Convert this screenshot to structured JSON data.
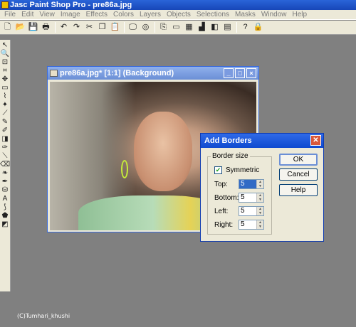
{
  "app": {
    "title": "Jasc Paint Shop Pro - pre86a.jpg"
  },
  "menu": [
    "File",
    "Edit",
    "View",
    "Image",
    "Effects",
    "Colors",
    "Layers",
    "Objects",
    "Selections",
    "Masks",
    "Window",
    "Help"
  ],
  "image_window": {
    "title": "pre86a.jpg* [1:1] (Background)"
  },
  "dialog": {
    "title": "Add Borders",
    "group_label": "Border size",
    "symmetric_label": "Symmetric",
    "symmetric_checked": true,
    "fields": [
      {
        "label": "Top:",
        "value": "5"
      },
      {
        "label": "Bottom:",
        "value": "5"
      },
      {
        "label": "Left:",
        "value": "5"
      },
      {
        "label": "Right:",
        "value": "5"
      }
    ],
    "buttons": {
      "ok": "OK",
      "cancel": "Cancel",
      "help": "Help"
    }
  },
  "watermark": "(C)Tumhari_khushi"
}
